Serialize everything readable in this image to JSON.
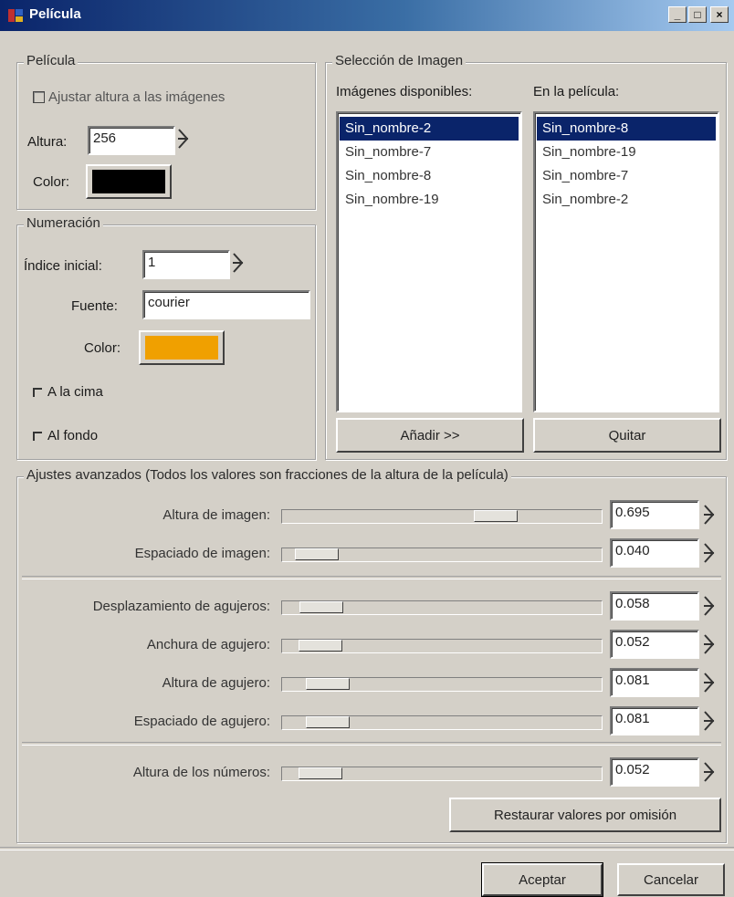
{
  "window": {
    "title": "Película",
    "buttons": {
      "minimize": "_",
      "maximize": "□",
      "close": "×"
    }
  },
  "pelicula": {
    "legend": "Película",
    "fit_height_label": "Ajustar altura a las imágenes",
    "height_label": "Altura:",
    "height_value": "256",
    "color_label": "Color:",
    "color": "#000000"
  },
  "numeracion": {
    "legend": "Numeración",
    "start_index_label": "Índice inicial:",
    "start_index_value": "1",
    "font_label": "Fuente:",
    "font_value": "courier",
    "color_label": "Color:",
    "color": "#f0a000",
    "top_label": "A la cima",
    "bottom_label": "Al fondo"
  },
  "seleccion": {
    "legend": "Selección de Imagen",
    "available_label": "Imágenes disponibles:",
    "in_film_label": "En la película:",
    "available": [
      "Sin_nombre-2",
      "Sin_nombre-7",
      "Sin_nombre-8",
      "Sin_nombre-19"
    ],
    "in_film": [
      "Sin_nombre-8",
      "Sin_nombre-19",
      "Sin_nombre-7",
      "Sin_nombre-2"
    ],
    "add_button": "Añadir >>",
    "remove_button": "Quitar"
  },
  "avanzados": {
    "legend": "Ajustes avanzados (Todos los valores son fracciones de la altura de la película)",
    "sliders": [
      {
        "label": "Altura de imagen:",
        "value": "0.695",
        "fraction": 0.695
      },
      {
        "label": "Espaciado de imagen:",
        "value": "0.040",
        "fraction": 0.04
      },
      {
        "label": "Desplazamiento de agujeros:",
        "value": "0.058",
        "fraction": 0.058
      },
      {
        "label": "Anchura de agujero:",
        "value": "0.052",
        "fraction": 0.052
      },
      {
        "label": "Altura de agujero:",
        "value": "0.081",
        "fraction": 0.081
      },
      {
        "label": "Espaciado de agujero:",
        "value": "0.081",
        "fraction": 0.081
      },
      {
        "label": "Altura de los números:",
        "value": "0.052",
        "fraction": 0.052
      }
    ],
    "reset_button": "Restaurar valores por omisión"
  },
  "footer": {
    "ok_button": "Aceptar",
    "cancel_button": "Cancelar"
  }
}
